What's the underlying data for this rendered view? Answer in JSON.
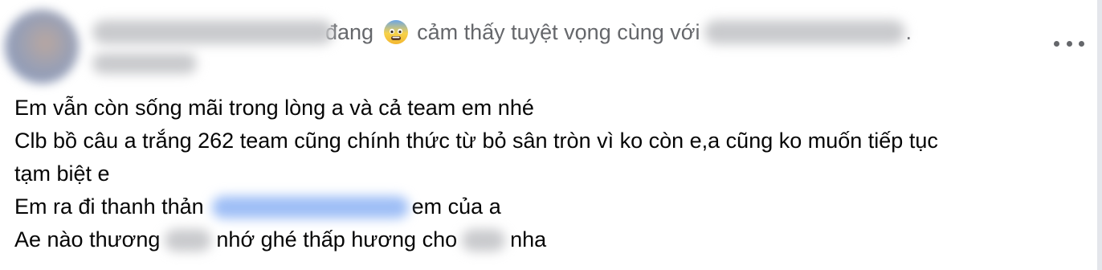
{
  "header": {
    "status_verb": "đang",
    "feeling_emoji": "😰",
    "feeling_text": "cảm thấy tuyệt vọng cùng với",
    "trailing_period": "."
  },
  "icons": {
    "feeling": "anxious-face-icon",
    "more": "more-options-icon"
  },
  "post": {
    "line1": "Em vẫn còn sống mãi trong lòng a và cả team em nhé",
    "line2": "Clb bồ câu a trắng 262 team cũng chính thức từ bỏ sân tròn vì ko còn e,a cũng ko muốn tiếp tục",
    "line3": "tạm biệt e",
    "line4_before": "Em ra đi thanh thản",
    "line4_after": "em của a",
    "line5_part1": "Ae nào thương",
    "line5_part2": "nhớ ghé thấp hương cho",
    "line5_part3": "nha"
  },
  "colors": {
    "text": "#050505",
    "secondary": "#65676b",
    "mention": "#216fdb"
  }
}
